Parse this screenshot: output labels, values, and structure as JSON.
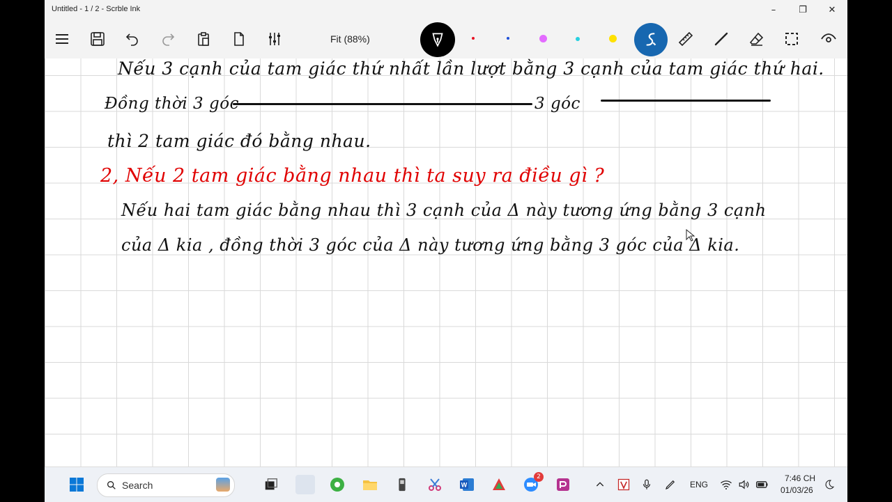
{
  "window": {
    "title": "Untitled - 1 / 2 - Scrble Ink",
    "minimize": "–",
    "maximize": "❐",
    "close": "✕"
  },
  "toolbar": {
    "zoom_label": "Fit (88%)",
    "pen_colors": [
      "#000000",
      "#e81123",
      "#1e90ff",
      "#e36bff",
      "#27d0e0",
      "#ffe100"
    ],
    "active_pen_color": "#1767b0"
  },
  "note": {
    "lines": [
      {
        "text": "Nếu 3 cạnh của tam giác thứ nhất lần lượt bằng 3 cạnh của tam giác thứ hai.",
        "color": "black"
      },
      {
        "text": "Đồng thời 3 góc",
        "color": "black"
      },
      {
        "text": "3 góc",
        "color": "black"
      },
      {
        "text": "thì 2 tam giác đó bằng nhau.",
        "color": "black"
      },
      {
        "text": "2, Nếu 2 tam giác bằng nhau thì ta suy ra điều gì ?",
        "color": "red"
      },
      {
        "text": "Nếu hai tam giác bằng nhau thì 3 cạnh của Δ này tương ứng bằng 3 cạnh",
        "color": "black"
      },
      {
        "text": "của Δ kia , đồng thời 3 góc của Δ này tương ứng bằng 3 góc của Δ kia.",
        "color": "black"
      }
    ]
  },
  "taskbar": {
    "search_label": "Search",
    "notification_badge": "2",
    "language": "ENG",
    "time": "7:46 CH",
    "date": "01/03/26"
  }
}
